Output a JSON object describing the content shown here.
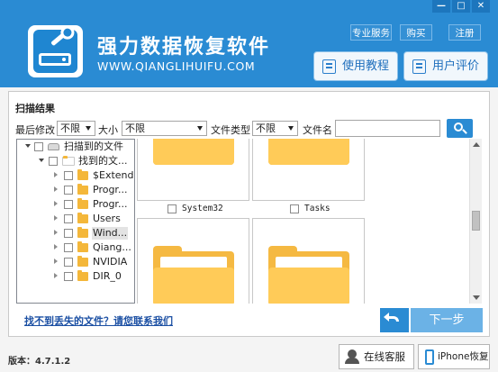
{
  "header": {
    "app_title": "强力数据恢复软件",
    "app_url": "WWW.QIANGLIHUIFU.COM",
    "top_links": [
      "专业服务",
      "购买",
      "注册"
    ],
    "window_controls": [
      "—",
      "□",
      "✕"
    ],
    "buttons": [
      {
        "label": "使用教程",
        "icon": "document-icon"
      },
      {
        "label": "用户评价",
        "icon": "message-icon"
      }
    ]
  },
  "panel": {
    "title": "扫描结果",
    "filters": {
      "modified_label": "最后修改",
      "modified_value": "不限",
      "size_label": "大小",
      "size_value": "不限",
      "type_label": "文件类型",
      "type_value": "不限",
      "name_label": "文件名",
      "name_value": ""
    }
  },
  "tree": {
    "items": [
      {
        "label": "扫描到的文件",
        "level": 0,
        "expander": "open",
        "icon": "drive-icon"
      },
      {
        "label": "找到的文...",
        "level": 1,
        "expander": "open",
        "icon": "white-folder-icon"
      },
      {
        "label": "$Extend",
        "level": 2,
        "expander": "closed",
        "icon": "folder-icon"
      },
      {
        "label": "Progr...",
        "level": 2,
        "expander": "closed",
        "icon": "folder-icon"
      },
      {
        "label": "Progr...",
        "level": 2,
        "expander": "closed",
        "icon": "folder-icon"
      },
      {
        "label": "Users",
        "level": 2,
        "expander": "closed",
        "icon": "folder-icon"
      },
      {
        "label": "Wind...",
        "level": 2,
        "expander": "closed",
        "icon": "folder-icon",
        "selected": true
      },
      {
        "label": "Qiang...",
        "level": 2,
        "expander": "closed",
        "icon": "folder-icon"
      },
      {
        "label": "NVIDIA",
        "level": 2,
        "expander": "closed",
        "icon": "folder-icon"
      },
      {
        "label": "DIR_0",
        "level": 2,
        "expander": "closed",
        "icon": "folder-icon"
      }
    ]
  },
  "grid": {
    "tiles": [
      {
        "caption": "System32"
      },
      {
        "caption": "Tasks"
      },
      {
        "caption": ""
      },
      {
        "caption": ""
      }
    ]
  },
  "actions": {
    "help_link": "找不到丢失的文件？请您联系我们",
    "next_label": "下一步"
  },
  "footer": {
    "version": "版本：4.7.1.2",
    "online_service": "在线客服",
    "iphone_recovery": "iPhone恢复"
  },
  "colors": {
    "header_blue": "#2a8bd3",
    "folder_yellow": "#f5b942",
    "link_blue": "#1b4fa3",
    "next_button": "#6bb2e6"
  }
}
